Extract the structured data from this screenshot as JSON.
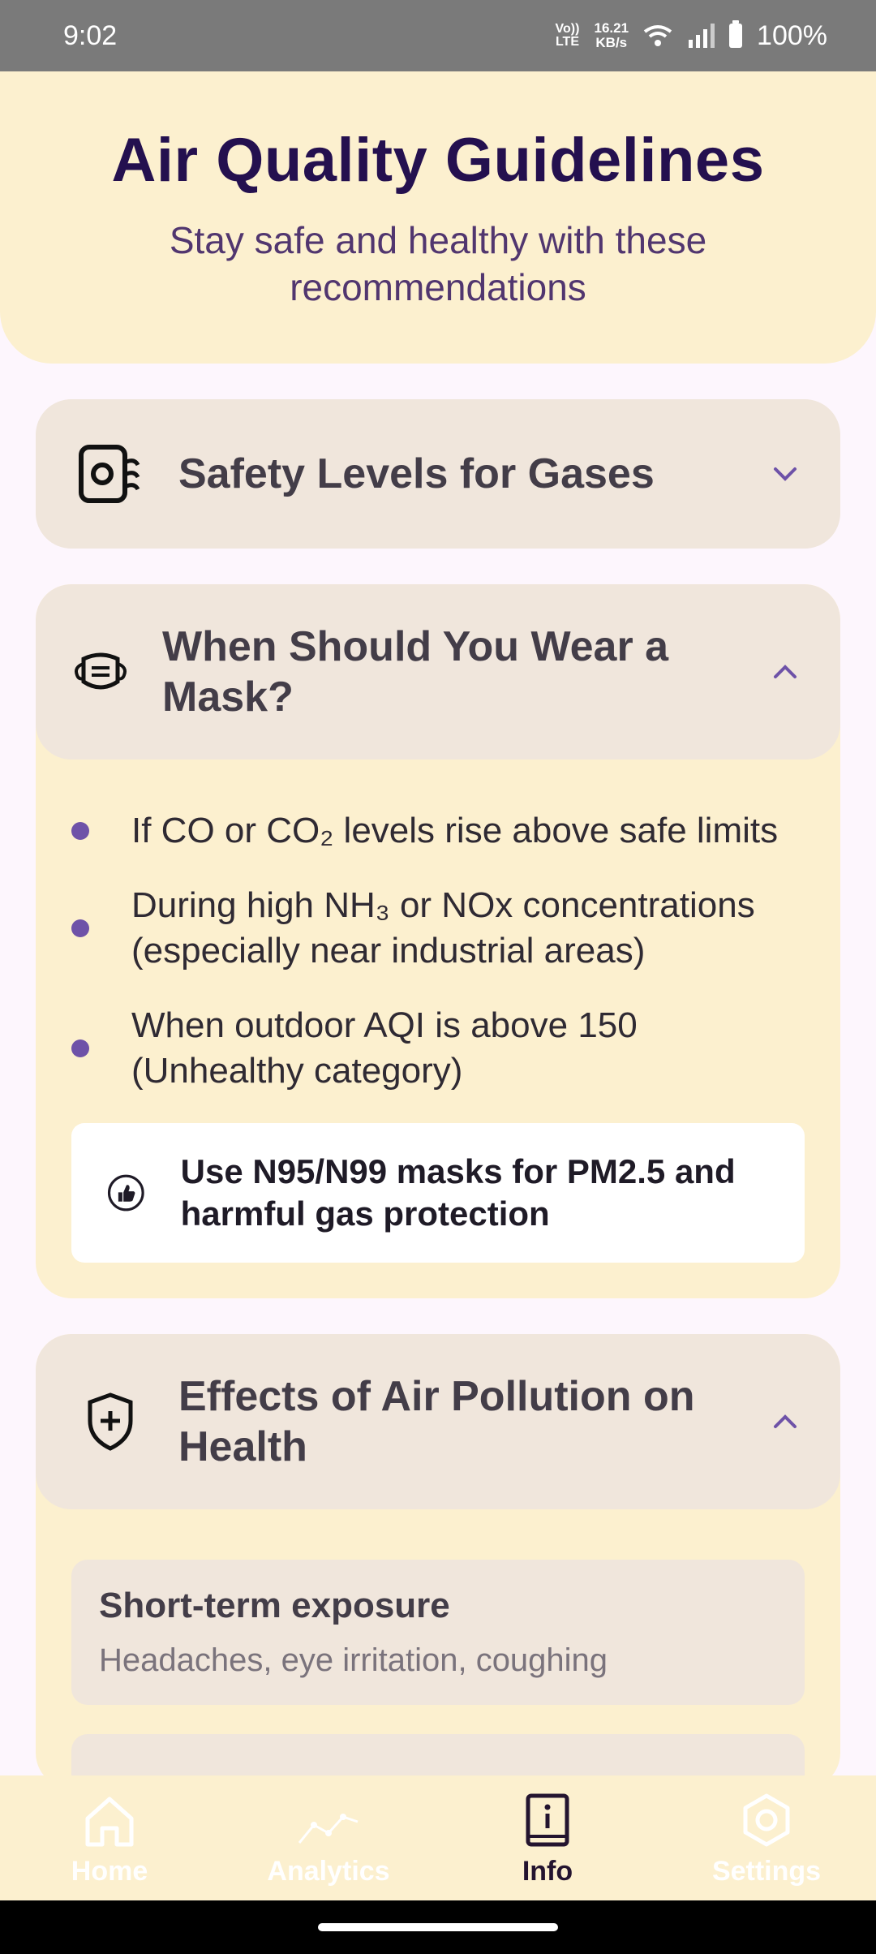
{
  "status_bar": {
    "time": "9:02",
    "volte": "Vo)) LTE",
    "net_speed_top": "16.21",
    "net_speed_bottom": "KB/s",
    "battery": "100%"
  },
  "header": {
    "title": "Air Quality Guidelines",
    "subtitle": "Stay safe and healthy with these recommendations"
  },
  "cards": {
    "safety": {
      "title": "Safety Levels for Gases",
      "icon": "gas-sensor-icon",
      "expanded": false
    },
    "mask": {
      "title": "When Should You Wear a Mask?",
      "icon": "face-mask-icon",
      "expanded": true,
      "bullets": [
        "If CO or CO₂ levels rise above safe limits",
        "During high NH₃ or NOx concentrations (especially near industrial areas)",
        "When outdoor AQI is above 150 (Unhealthy category)"
      ],
      "tip": "Use N95/N99 masks for PM2.5 and harmful gas protection",
      "tip_icon": "thumbs-up-icon"
    },
    "effects": {
      "title": "Effects of Air Pollution on Health",
      "icon": "shield-plus-icon",
      "expanded": true,
      "items": [
        {
          "title": "Short-term exposure",
          "desc": "Headaches, eye irritation, coughing"
        }
      ]
    }
  },
  "nav": {
    "home": "Home",
    "analytics": "Analytics",
    "info": "Info",
    "settings": "Settings",
    "active": "info"
  },
  "colors": {
    "accent": "#6e52a8",
    "header_bg": "#fcf0cf",
    "card_header_bg": "#f0e6dc",
    "title": "#24104f"
  }
}
